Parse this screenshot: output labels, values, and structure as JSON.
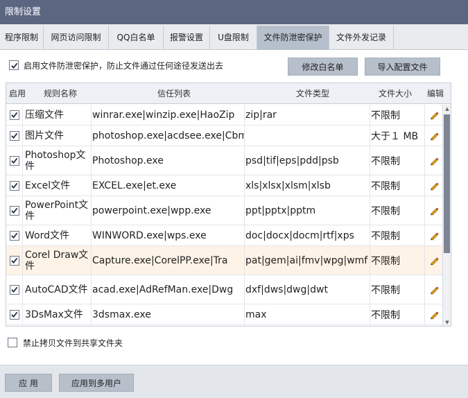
{
  "window": {
    "title": "限制设置"
  },
  "tabs": [
    {
      "label": "程序限制"
    },
    {
      "label": "网页访问限制"
    },
    {
      "label": "QQ白名单"
    },
    {
      "label": "报警设置"
    },
    {
      "label": "U盘限制"
    },
    {
      "label": "文件防泄密保护",
      "active": true
    },
    {
      "label": "文件外发记录"
    }
  ],
  "protection": {
    "enable_label": "启用文件防泄密保护，防止文件通过任何途径发送出去",
    "enabled": true,
    "modify_whitelist_label": "修改白名单",
    "import_config_label": "导入配置文件"
  },
  "grid": {
    "headers": {
      "enable": "启用",
      "rule": "规则名称",
      "trust": "信任列表",
      "type": "文件类型",
      "size": "文件大小",
      "edit": "编辑"
    },
    "rows": [
      {
        "enabled": true,
        "name": "压缩文件",
        "trust": "winrar.exe|winzip.exe|HaoZip",
        "type": "zip|rar",
        "size": "不限制"
      },
      {
        "enabled": true,
        "name": "图片文件",
        "trust": "photoshop.exe|acdsee.exe|Cbmp|jpg|png",
        "type": "",
        "size": "大于１ MB"
      },
      {
        "enabled": true,
        "name": "Photoshop文件",
        "trust": "Photoshop.exe",
        "type": "psd|tif|eps|pdd|psb",
        "size": "不限制"
      },
      {
        "enabled": true,
        "name": "Excel文件",
        "trust": "EXCEL.exe|et.exe",
        "type": "xls|xlsx|xlsm|xlsb",
        "size": "不限制"
      },
      {
        "enabled": true,
        "name": "PowerPoint文件",
        "trust": "powerpoint.exe|wpp.exe",
        "type": "ppt|pptx|pptm",
        "size": "不限制"
      },
      {
        "enabled": true,
        "name": "Word文件",
        "trust": "WINWORD.exe|wps.exe",
        "type": "doc|docx|docm|rtf|xps",
        "size": "不限制"
      },
      {
        "enabled": true,
        "name": "Corel Draw文件",
        "trust": "Capture.exe|CorelPP.exe|Tra",
        "type": "pat|gem|ai|fmv|wpg|wmf",
        "size": "不限制",
        "highlighted": true
      },
      {
        "enabled": true,
        "name": "AutoCAD文件",
        "trust": "acad.exe|AdRefMan.exe|Dwg",
        "type": "dxf|dws|dwg|dwt",
        "size": "不限制"
      },
      {
        "enabled": true,
        "name": "3DsMax文件",
        "trust": "3dsmax.exe",
        "type": "max",
        "size": "不限制"
      }
    ]
  },
  "share_block": {
    "label": "禁止拷贝文件到共享文件夹",
    "checked": false
  },
  "footer": {
    "apply_label": "应 用",
    "apply_multi_label": "应用到多用户"
  },
  "colors": {
    "titlebar": "#5b6680",
    "active_tab": "#b6bfcc",
    "button": "#b7bfcb",
    "highlight_row": "#fdf3e7",
    "pencil": "#e3a51c"
  }
}
